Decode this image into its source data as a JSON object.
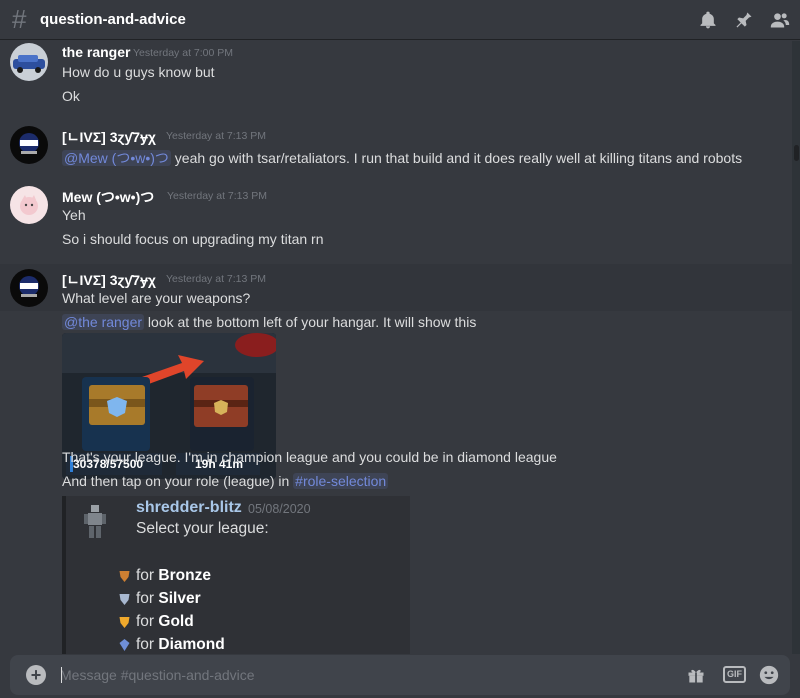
{
  "header": {
    "hash_symbol": "#",
    "channel_name": "question-and-advice",
    "icons": [
      "bell-icon",
      "pin-icon",
      "members-icon"
    ]
  },
  "messages": [
    {
      "author": "the ranger",
      "timestamp": "Yesterday at 7:00 PM",
      "lines": [
        "How do u guys know but",
        "Ok"
      ]
    },
    {
      "author": "[ㄴIVΣ] 3ɀƴ7ɏχ",
      "timestamp": "Yesterday at 7:13 PM",
      "mention": "@Mew (つ•w•)つ",
      "line_rest": " yeah go with tsar/retaliators. I run that build and it does really well at killing titans and robots"
    },
    {
      "author": "Mew (つ•w•)つ",
      "timestamp": "Yesterday at 7:13 PM",
      "lines": [
        "Yeh",
        "So i should focus on upgrading my titan rn"
      ]
    },
    {
      "author": "[ㄴIVΣ] 3ɀƴ7ɏχ",
      "timestamp": "Yesterday at 7:13 PM",
      "line1": "What level are your weapons?",
      "mention": "@the ranger",
      "line2_rest": " look at the bottom left of your hangar. It will show this",
      "image": {
        "left_label": "30378/57500",
        "right_label": "19h 41m"
      },
      "line3": "That's your league. I'm in champion league and you could be in diamond league",
      "line4_prefix": "And then tap on your role (league) in ",
      "channel_mention": "#role-selection",
      "embed": {
        "name": "shredder-blitz",
        "date": "05/08/2020",
        "text": "Select your league:",
        "leagues": [
          {
            "prefix": "for ",
            "name": "Bronze",
            "color": "#cd7f32"
          },
          {
            "prefix": "for ",
            "name": "Silver",
            "color": "#a8b8d0"
          },
          {
            "prefix": "for ",
            "name": "Gold",
            "color": "#f0a92c"
          },
          {
            "prefix": "for ",
            "name": "Diamond",
            "color": "#6f8fd8"
          }
        ]
      }
    }
  ],
  "composer": {
    "placeholder": "Message #question-and-advice",
    "gif_label": "GIF"
  },
  "colors": {
    "background": "#36393f",
    "mention": "#7289da",
    "embed_name": "#a9c7e8"
  }
}
